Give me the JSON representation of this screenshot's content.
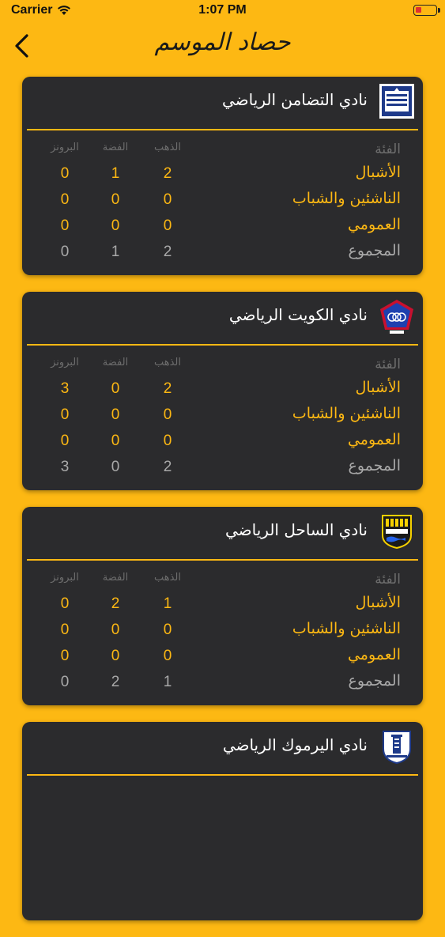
{
  "status_bar": {
    "carrier": "Carrier",
    "time": "1:07 PM"
  },
  "nav": {
    "title": "حصاد الموسم"
  },
  "headers": {
    "category": "الفئة",
    "gold": "الذهب",
    "silver": "الفضة",
    "bronze": "البرونز"
  },
  "clubs": [
    {
      "name": "نادي التضامن الرياضي",
      "rows": [
        {
          "category": "الأشبال",
          "gold": "2",
          "silver": "1",
          "bronze": "0"
        },
        {
          "category": "الناشئين والشباب",
          "gold": "0",
          "silver": "0",
          "bronze": "0"
        },
        {
          "category": "العمومي",
          "gold": "0",
          "silver": "0",
          "bronze": "0"
        }
      ],
      "total": {
        "category": "المجموع",
        "gold": "2",
        "silver": "1",
        "bronze": "0"
      }
    },
    {
      "name": "نادي الكويت الرياضي",
      "rows": [
        {
          "category": "الأشبال",
          "gold": "2",
          "silver": "0",
          "bronze": "3"
        },
        {
          "category": "الناشئين والشباب",
          "gold": "0",
          "silver": "0",
          "bronze": "0"
        },
        {
          "category": "العمومي",
          "gold": "0",
          "silver": "0",
          "bronze": "0"
        }
      ],
      "total": {
        "category": "المجموع",
        "gold": "2",
        "silver": "0",
        "bronze": "3"
      }
    },
    {
      "name": "نادي الساحل الرياضي",
      "rows": [
        {
          "category": "الأشبال",
          "gold": "1",
          "silver": "2",
          "bronze": "0"
        },
        {
          "category": "الناشئين والشباب",
          "gold": "0",
          "silver": "0",
          "bronze": "0"
        },
        {
          "category": "العمومي",
          "gold": "0",
          "silver": "0",
          "bronze": "0"
        }
      ],
      "total": {
        "category": "المجموع",
        "gold": "1",
        "silver": "2",
        "bronze": "0"
      }
    },
    {
      "name": "نادي اليرموك الرياضي"
    }
  ],
  "colors": {
    "background": "#fdb813",
    "card": "#2b2b2d",
    "accent": "#fdb813",
    "header_text": "#6d6d6d",
    "total_text": "#a9a9a9"
  }
}
